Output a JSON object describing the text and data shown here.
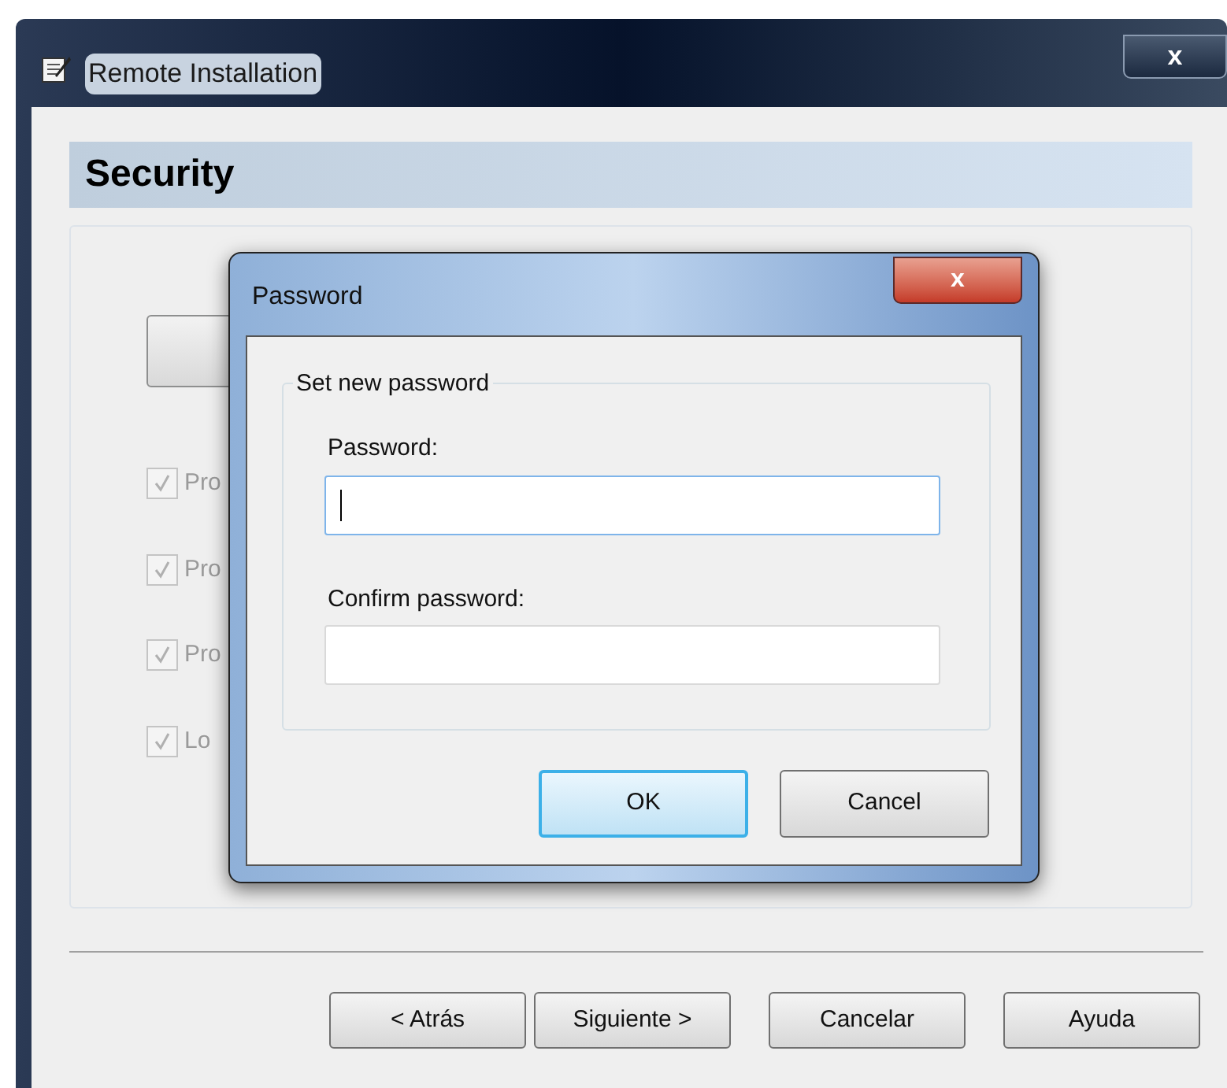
{
  "window": {
    "title": "Remote Installation",
    "close": "x"
  },
  "header": {
    "title": "Security"
  },
  "options": [
    {
      "label": "Pro",
      "checked": true,
      "disabled": true
    },
    {
      "label": "Pro",
      "checked": true,
      "disabled": true
    },
    {
      "label": "Pro",
      "checked": true,
      "disabled": true
    },
    {
      "label": "Lo",
      "checked": true,
      "disabled": true
    }
  ],
  "buttons": [
    {
      "label": "< Atrás"
    },
    {
      "label": "Siguiente >"
    },
    {
      "label": "Cancelar"
    },
    {
      "label": "Ayuda"
    }
  ],
  "dialog": {
    "title": "Password",
    "close": "x",
    "group": "Set new password",
    "fields": [
      {
        "label": "Password:",
        "focused": true
      },
      {
        "label": "Confirm password:",
        "focused": false
      }
    ],
    "buttons": [
      {
        "label": "OK",
        "default": true
      },
      {
        "label": "Cancel",
        "default": false
      }
    ]
  }
}
